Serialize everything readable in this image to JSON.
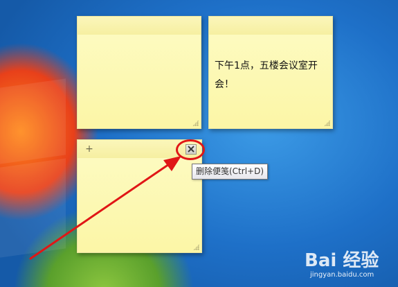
{
  "notes": [
    {
      "id": "note-1",
      "text": ""
    },
    {
      "id": "note-2",
      "text": "下午1点，五楼会议室开会！"
    },
    {
      "id": "note-3",
      "text": ""
    }
  ],
  "note_controls": {
    "add_glyph": "+",
    "close_icon": "close-icon"
  },
  "tooltip": {
    "text": "删除便笺(Ctrl+D)"
  },
  "watermark": {
    "logo": "Bai 经验",
    "url": "jingyan.baidu.com"
  },
  "colors": {
    "note_body": "#fcf6a6",
    "annotation_red": "#e01616",
    "desktop_blue": "#1e70c8"
  }
}
